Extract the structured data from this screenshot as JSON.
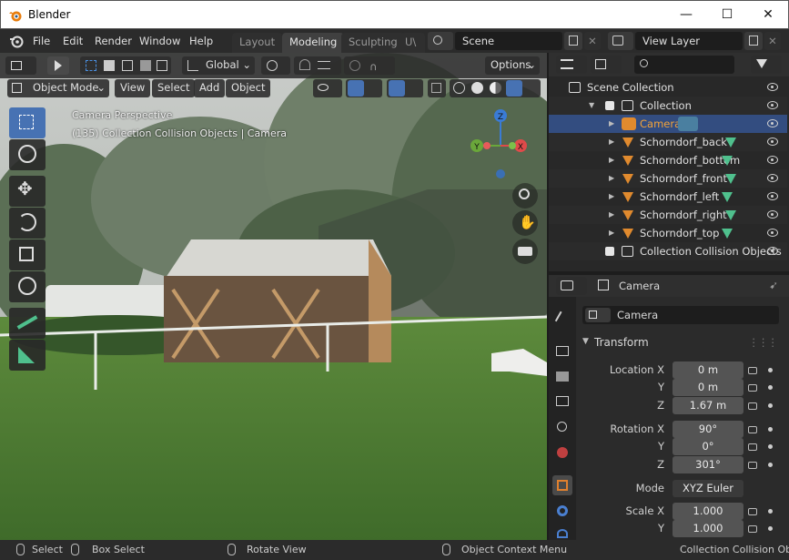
{
  "window": {
    "title": "Blender"
  },
  "menu": {
    "items": [
      "File",
      "Edit",
      "Render",
      "Window",
      "Help"
    ]
  },
  "workspaces": [
    {
      "label": "Layout",
      "active": false
    },
    {
      "label": "Modeling",
      "active": true
    },
    {
      "label": "Sculpting",
      "active": false
    },
    {
      "label": "U\\",
      "active": false
    }
  ],
  "scene": {
    "name": "Scene",
    "view_layer": "View Layer"
  },
  "viewport": {
    "transform_orientation": "Global",
    "options_label": "Options",
    "mode": "Object Mode",
    "header_menus": [
      "View",
      "Select",
      "Add",
      "Object"
    ],
    "overlay_title": "Camera Perspective",
    "overlay_subtitle": "(135) Collection Collision Objects | Camera",
    "gizmo": {
      "x": "X",
      "y": "Y",
      "z": "Z"
    }
  },
  "outliner": {
    "rows": [
      {
        "label": "Scene Collection",
        "indent": 0,
        "type": "scene"
      },
      {
        "label": "Collection",
        "indent": 1,
        "type": "collection"
      },
      {
        "label": "Camera",
        "indent": 2,
        "type": "camera",
        "selected": true
      },
      {
        "label": "Schorndorf_back",
        "indent": 2,
        "type": "mesh"
      },
      {
        "label": "Schorndorf_bottom",
        "indent": 2,
        "type": "mesh"
      },
      {
        "label": "Schorndorf_front",
        "indent": 2,
        "type": "mesh"
      },
      {
        "label": "Schorndorf_left",
        "indent": 2,
        "type": "mesh"
      },
      {
        "label": "Schorndorf_right",
        "indent": 2,
        "type": "mesh"
      },
      {
        "label": "Schorndorf_top",
        "indent": 2,
        "type": "mesh"
      },
      {
        "label": "Collection Collision Objects",
        "indent": 1,
        "type": "collection"
      }
    ]
  },
  "properties": {
    "header_name": "Camera",
    "object_name": "Camera",
    "panel_title": "Transform",
    "fields": [
      {
        "label": "Location X",
        "value": "0 m"
      },
      {
        "label": "Y",
        "value": "0 m"
      },
      {
        "label": "Z",
        "value": "1.67 m"
      },
      {
        "label": "Rotation X",
        "value": "90°"
      },
      {
        "label": "Y",
        "value": "0°"
      },
      {
        "label": "Z",
        "value": "301°"
      },
      {
        "label": "Mode",
        "value": "XYZ Euler"
      },
      {
        "label": "Scale X",
        "value": "1.000"
      },
      {
        "label": "Y",
        "value": "1.000"
      }
    ]
  },
  "status": {
    "select": "Select",
    "box_select": "Box Select",
    "rotate_view": "Rotate View",
    "context_menu": "Object Context Menu",
    "right": "Collection Collision Obj"
  },
  "colors": {
    "accent": "#4772b3",
    "selected_row": "#334d80",
    "camera_orange": "#e08a2e",
    "mesh_green": "#4fc08d"
  }
}
